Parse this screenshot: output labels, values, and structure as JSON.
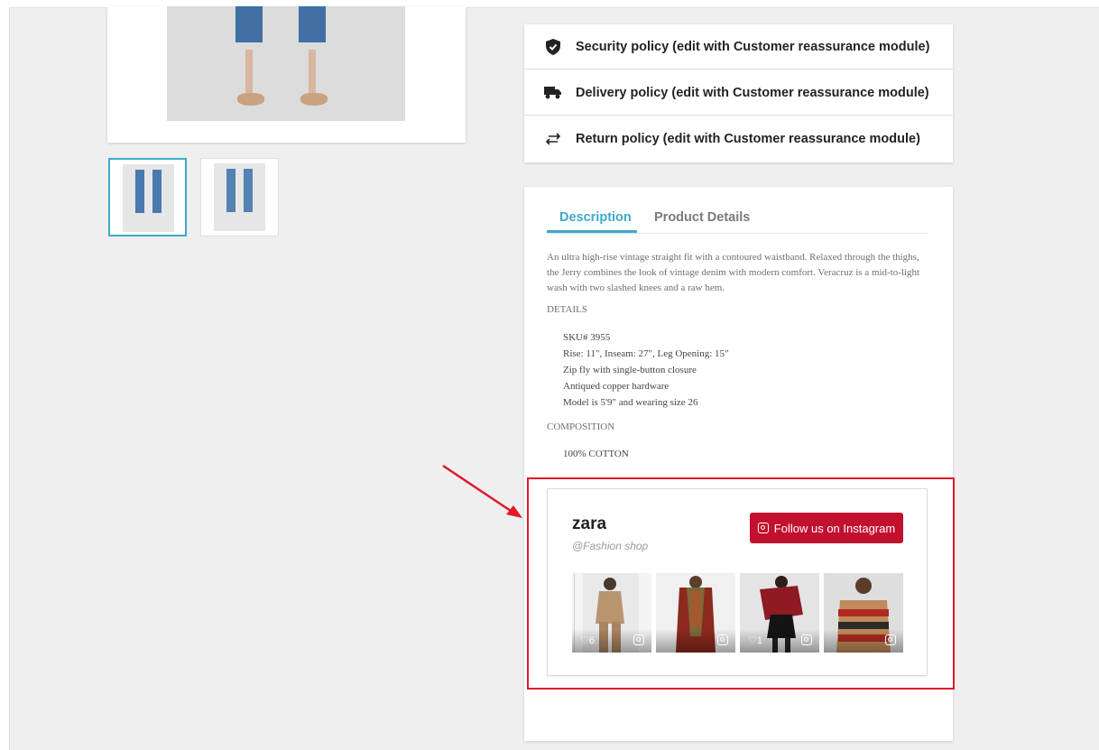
{
  "policies": [
    {
      "icon": "shield-check-icon",
      "label": "Security policy (edit with Customer reassurance module)"
    },
    {
      "icon": "truck-icon",
      "label": "Delivery policy (edit with Customer reassurance module)"
    },
    {
      "icon": "swap-arrows-icon",
      "label": "Return policy (edit with Customer reassurance module)"
    }
  ],
  "tabs": {
    "description": "Description",
    "product_details": "Product Details"
  },
  "description": {
    "paragraph": "An ultra high-rise vintage straight fit with a contoured waistband. Relaxed through the thighs, the Jerry combines the look of vintage denim with modern comfort. Veracruz is a mid-to-light wash with two slashed knees and a raw hem.",
    "details_label": "DETAILS",
    "details": [
      "SKU# 3955",
      "Rise: 11\", Inseam: 27\", Leg Opening: 15\"",
      "Zip fly with single-button closure",
      "Antiqued copper hardware",
      "Model is 5'9\" and wearing size 26"
    ],
    "composition_label": "COMPOSITION",
    "composition": "100% COTTON"
  },
  "instagram": {
    "name": "zara",
    "handle": "@Fashion shop",
    "follow_label": "Follow us on Instagram",
    "button_color": "#c2102f",
    "posts": [
      {
        "likes": "6"
      },
      {
        "likes": ""
      },
      {
        "likes": "1"
      },
      {
        "likes": ""
      }
    ]
  },
  "colors": {
    "accent": "#3fa9c9",
    "highlight": "#e0182a"
  }
}
